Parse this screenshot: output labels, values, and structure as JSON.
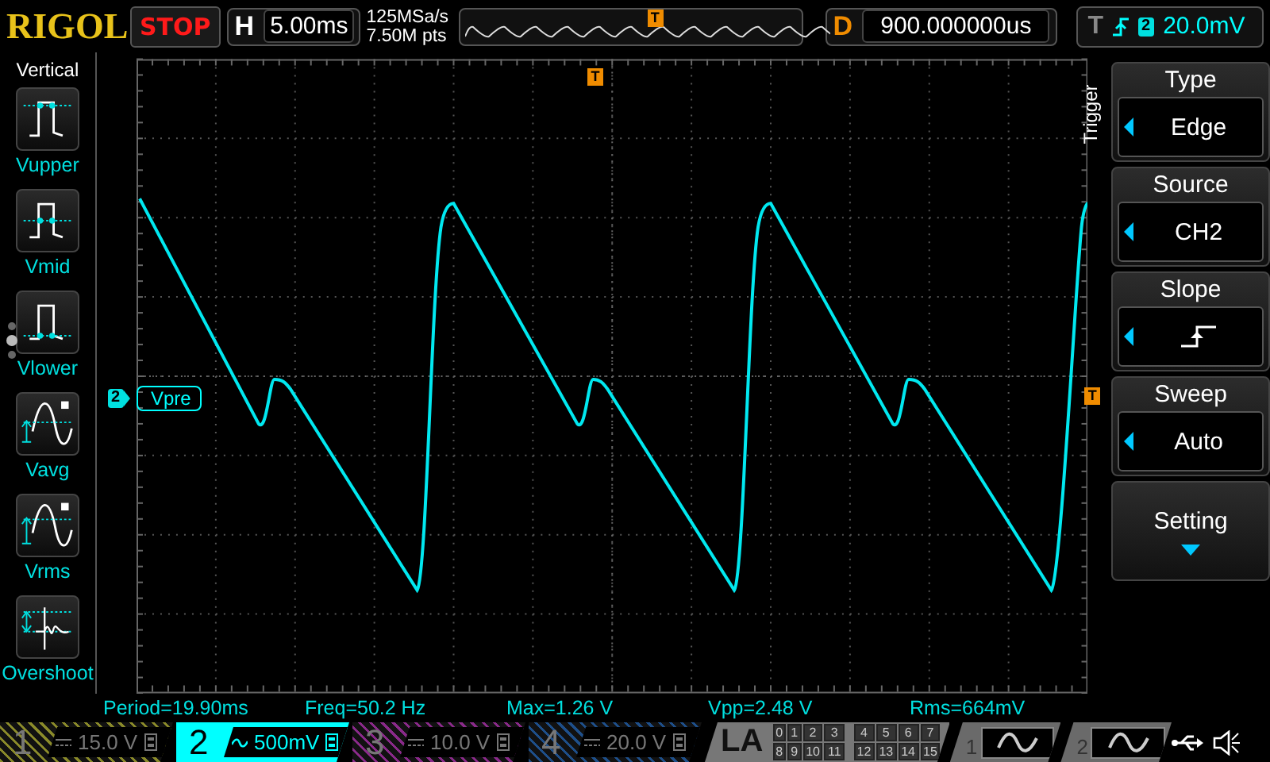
{
  "brand": "RIGOL",
  "run_status": "STOP",
  "horizontal": {
    "label": "H",
    "value": "5.00ms"
  },
  "acquisition": {
    "sample_rate": "125MSa/s",
    "memory_depth": "7.50M pts",
    "trigger_marker": "T"
  },
  "delay": {
    "label": "D",
    "value": "900.000000us"
  },
  "trigger_status": {
    "label": "T",
    "source": "2",
    "level": "20.0mV"
  },
  "left_menu": {
    "title": "Vertical",
    "items": [
      {
        "label": "Vupper",
        "kind": "upper"
      },
      {
        "label": "Vmid",
        "kind": "mid"
      },
      {
        "label": "Vlower",
        "kind": "lower"
      },
      {
        "label": "Vavg",
        "kind": "avg"
      },
      {
        "label": "Vrms",
        "kind": "rms"
      },
      {
        "label": "Overshoot",
        "kind": "overshoot"
      }
    ]
  },
  "scope": {
    "channel_marker": "2",
    "channel_label": "Vpre",
    "trigger_position_marker": "T",
    "trigger_level_marker": "T"
  },
  "right_menu": {
    "title": "Trigger",
    "items": [
      {
        "kind": "value",
        "title": "Type",
        "value": "Edge"
      },
      {
        "kind": "value",
        "title": "Source",
        "value": "CH2"
      },
      {
        "kind": "slope",
        "title": "Slope"
      },
      {
        "kind": "value",
        "title": "Sweep",
        "value": "Auto"
      },
      {
        "kind": "submenu",
        "title": "Setting"
      }
    ]
  },
  "measurements": [
    "Period=19.90ms",
    "Freq=50.2 Hz",
    "Max=1.26 V",
    "Vpp=2.48 V",
    "Rms=664mV"
  ],
  "channels": [
    {
      "number": "1",
      "kind": "dc",
      "scale": "15.0 V",
      "selected": false,
      "color": "#8a8a2a"
    },
    {
      "number": "2",
      "kind": "ac",
      "scale": "500mV",
      "selected": true,
      "color": "#00ffff"
    },
    {
      "number": "3",
      "kind": "dc",
      "scale": "10.0 V",
      "selected": false,
      "color": "#8a2a8a"
    },
    {
      "number": "4",
      "kind": "dc",
      "scale": "20.0 V",
      "selected": false,
      "color": "#1e4f8a"
    }
  ],
  "logic_analyzer": {
    "label": "LA",
    "digital_channels": [
      "0",
      "1",
      "2",
      "3",
      "4",
      "5",
      "6",
      "7",
      "8",
      "9",
      "10",
      "11",
      "12",
      "13",
      "14",
      "15"
    ]
  },
  "generators": [
    {
      "number": "1"
    },
    {
      "number": "2"
    }
  ]
}
